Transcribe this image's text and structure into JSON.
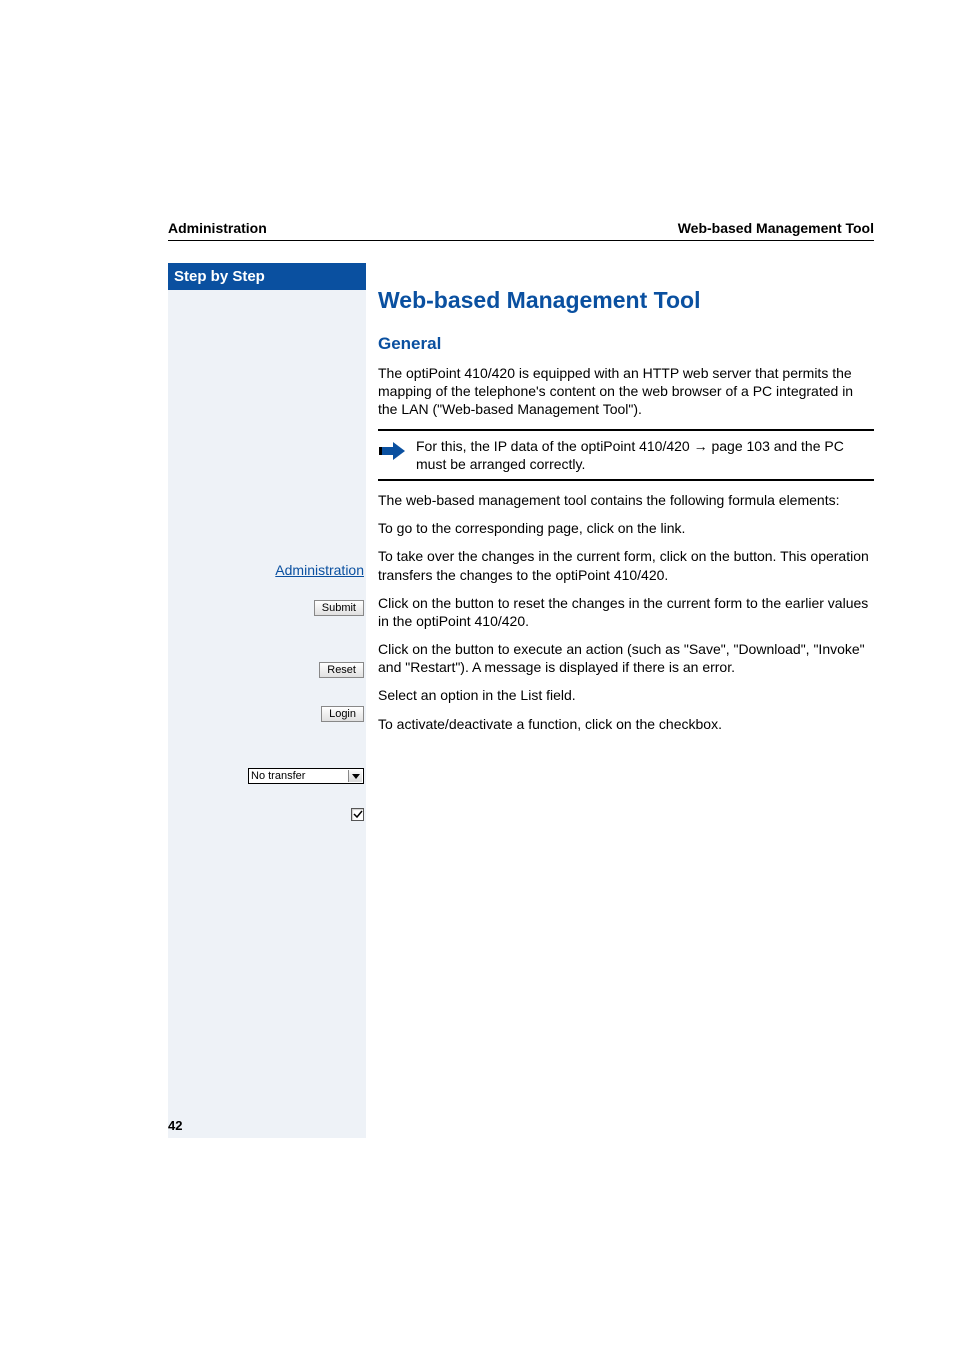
{
  "header": {
    "left": "Administration",
    "right": "Web-based Management Tool"
  },
  "sidebar": {
    "title": "Step by Step",
    "link": "Administration",
    "buttons": {
      "submit": "Submit",
      "reset": "Reset",
      "login": "Login"
    },
    "select_value": "No transfer"
  },
  "content": {
    "h1": "Web-based Management Tool",
    "h2": "General",
    "p1": "The optiPoint 410/420 is equipped with an HTTP web server that permits the mapping of the telephone's content on the web browser of a PC integrated in the LAN (\"Web-based Management Tool\").",
    "note": "For this, the IP data of the optiPoint 410/420 → page 103 and the PC must be arranged correctly.",
    "p2": "The web-based management tool contains the following formula elements:",
    "rows": {
      "link": "To go to the corresponding page, click on the link.",
      "submit": "To take over the changes in the current form, click on the button. This operation transfers the changes to the optiPoint 410/420.",
      "reset": "Click on the button to reset the changes in the current form to the earlier values in the optiPoint 410/420.",
      "login": "Click on the button to execute an action (such as \"Save\", \"Download\", \"Invoke\" and \"Restart\"). A message is displayed if there is an error.",
      "select": "Select an option in the List field.",
      "checkbox": "To activate/deactivate a function, click on the checkbox."
    }
  },
  "page_number": "42"
}
